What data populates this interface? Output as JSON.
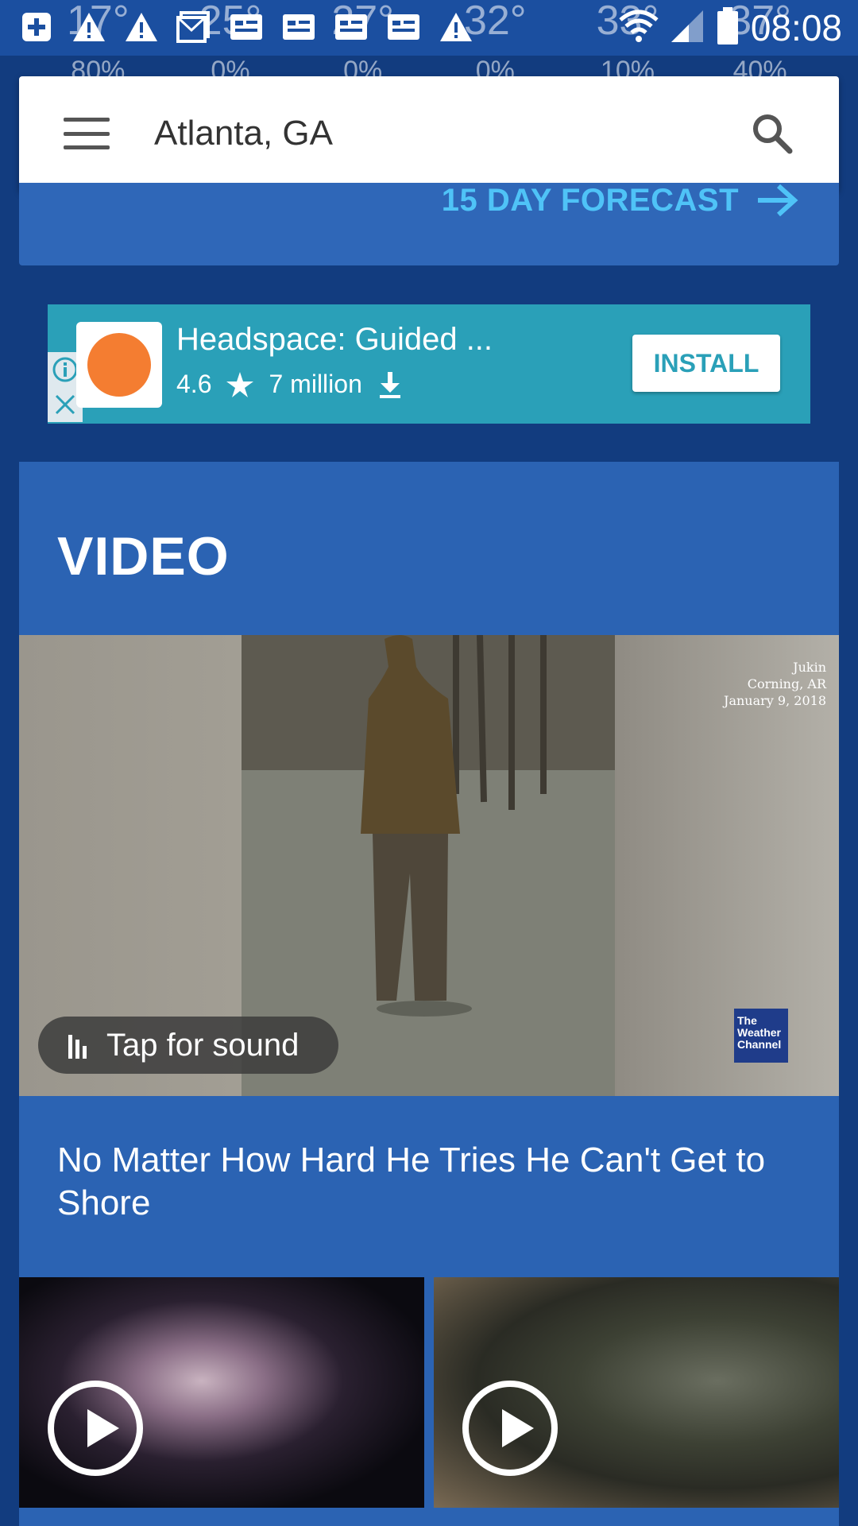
{
  "status_bar": {
    "time": "08:08",
    "icons_left": [
      "add-icon",
      "alert-icon",
      "alert-icon",
      "mail-icon",
      "card-icon",
      "card-icon",
      "card-icon",
      "card-icon",
      "alert-icon"
    ],
    "icons_right": [
      "wifi-icon",
      "signal-icon",
      "battery-icon"
    ]
  },
  "hourly_ghost": [
    {
      "temp": "17°",
      "pct": "80%"
    },
    {
      "temp": "25°",
      "pct": "0%"
    },
    {
      "temp": "27°",
      "pct": "0%"
    },
    {
      "temp": "32°",
      "pct": "0%"
    },
    {
      "temp": "33°",
      "pct": "10%"
    },
    {
      "temp": "37°",
      "pct": "40%"
    }
  ],
  "search": {
    "location": "Atlanta, GA"
  },
  "forecast": {
    "link_label": "15 DAY FORECAST"
  },
  "ad": {
    "title": "Headspace: Guided ...",
    "rating": "4.6",
    "downloads": "7 million",
    "install_label": "INSTALL"
  },
  "video": {
    "heading": "VIDEO",
    "credit_line1": "Jukin",
    "credit_line2": "Corning, AR",
    "credit_line3": "January 9, 2018",
    "watermark_line1": "The",
    "watermark_line2": "Weather",
    "watermark_line3": "Channel",
    "tap_label": "Tap for sound",
    "title": "No Matter How Hard He Tries He Can't Get to Shore"
  },
  "colors": {
    "background": "#123c7f",
    "card": "#2b63b3",
    "accent_link": "#4fc3f7",
    "ad_bg": "#2aa0b8",
    "ad_logo": "#f47d31"
  }
}
